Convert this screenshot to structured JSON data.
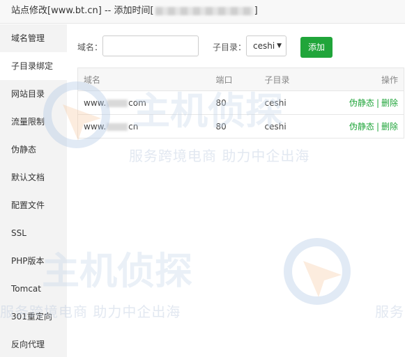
{
  "title": {
    "prefix": "站点修改[www.bt.cn] -- 添加时间[",
    "suffix": "]"
  },
  "sidebar": {
    "items": [
      {
        "label": "域名管理"
      },
      {
        "label": "子目录绑定"
      },
      {
        "label": "网站目录"
      },
      {
        "label": "流量限制"
      },
      {
        "label": "伪静态"
      },
      {
        "label": "默认文档"
      },
      {
        "label": "配置文件"
      },
      {
        "label": "SSL"
      },
      {
        "label": "PHP版本"
      },
      {
        "label": "Tomcat"
      },
      {
        "label": "301重定向"
      },
      {
        "label": "反向代理"
      }
    ],
    "active_index": 1
  },
  "form": {
    "domain_label": "域名：",
    "domain_value": "",
    "subdir_label": "子目录：",
    "subdir_selected": "ceshi",
    "add_button": "添加"
  },
  "table": {
    "headers": {
      "domain": "域名",
      "port": "端口",
      "dir": "子目录",
      "op": "操作"
    },
    "rows": [
      {
        "domain_pre": "www.",
        "domain_post": "com",
        "port": "80",
        "dir": "ceshi",
        "op_rewrite": "伪静态",
        "op_sep": "|",
        "op_delete": "删除"
      },
      {
        "domain_pre": "www.",
        "domain_post": "cn",
        "port": "80",
        "dir": "ceshi",
        "op_rewrite": "伪静态",
        "op_sep": "|",
        "op_delete": "删除"
      }
    ]
  },
  "watermark": {
    "slogan": "服务跨境电商 助力中企出海",
    "brand": "主机侦探",
    "short": "服务"
  },
  "colors": {
    "accent": "#20a53a",
    "sidebar_bg": "#f3f3f3",
    "titlebar_bg": "#f8f8f8"
  }
}
